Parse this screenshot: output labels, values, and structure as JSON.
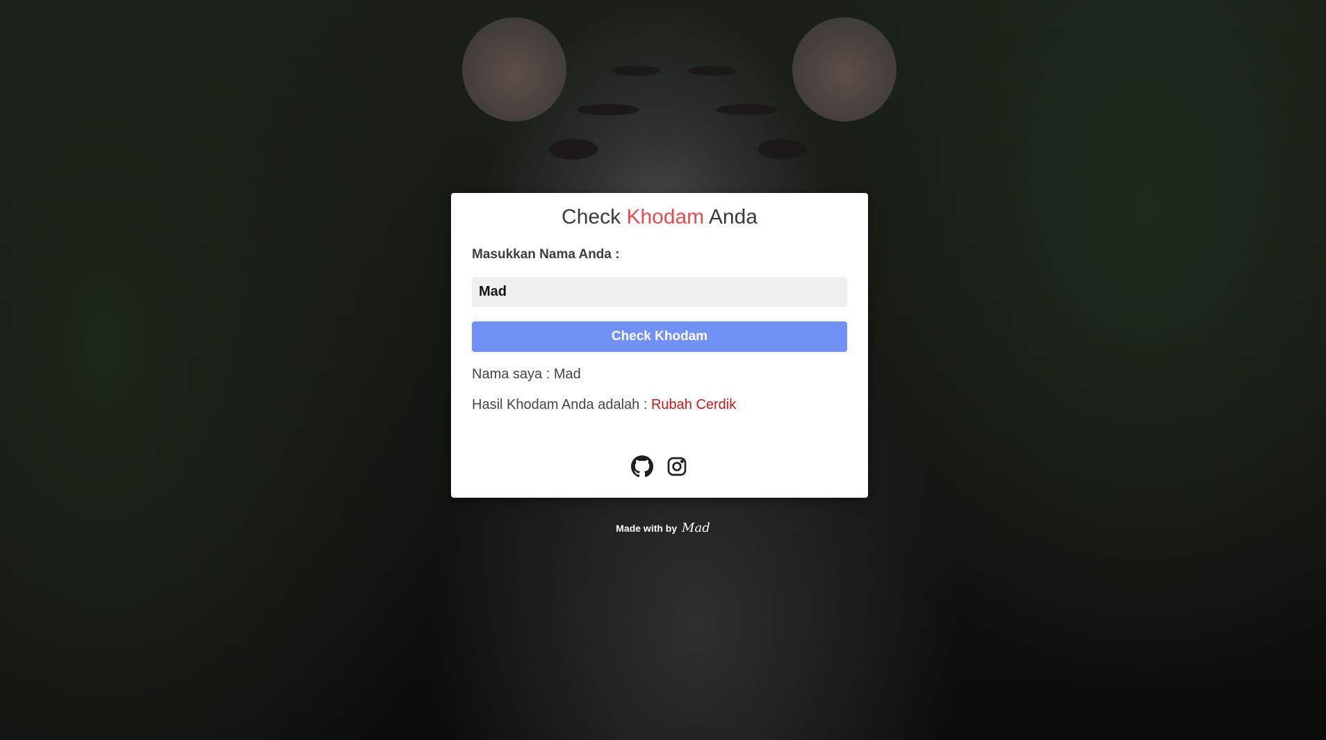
{
  "header": {
    "title_prefix": "Check",
    "title_accent": "Khodam",
    "title_suffix": "Anda"
  },
  "form": {
    "label": "Masukkan Nama Anda :",
    "name_value": "Mad",
    "button_label": "Check Khodam"
  },
  "result": {
    "name_line_label": "Nama saya : ",
    "name_line_value": "Mad",
    "khodam_line_label": "Hasil Khodam Anda adalah : ",
    "khodam_line_value": "Rubah Cerdik"
  },
  "socials": {
    "items": [
      {
        "icon": "github-icon"
      },
      {
        "icon": "instagram-icon"
      }
    ]
  },
  "footer": {
    "made_with": "Made with by",
    "author": "Mad"
  },
  "colors": {
    "accent": "#e84b4b",
    "button": "#7191f5",
    "result_value": "#cc1515"
  }
}
